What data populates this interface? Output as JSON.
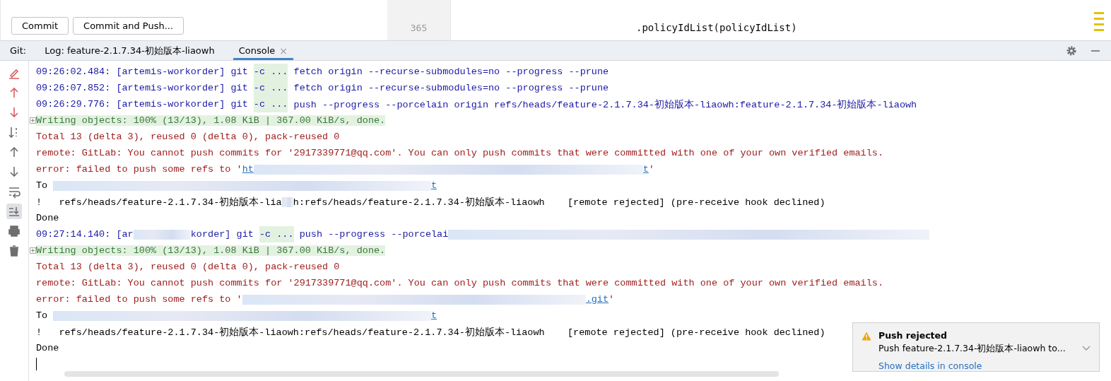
{
  "commit_buttons": [
    "Commit",
    "Commit and Push..."
  ],
  "editor": {
    "line_number": "365",
    "code": ".policyIdList(policyIdList)"
  },
  "tool_window": {
    "label": "Git:",
    "tabs": [
      {
        "label": "Log: feature-2.1.7.34-初始版本-liaowh",
        "selected": false
      },
      {
        "label": "Console",
        "selected": true,
        "close": "×"
      }
    ]
  },
  "toolbar": [
    {
      "kind": "pen",
      "on": false
    },
    {
      "kind": "up-red",
      "on": false
    },
    {
      "kind": "down-red",
      "on": false
    },
    {
      "kind": "sort",
      "on": false
    },
    {
      "kind": "up",
      "on": false
    },
    {
      "kind": "down",
      "on": false
    },
    {
      "kind": "wrap",
      "on": false
    },
    {
      "kind": "scroll-end",
      "on": true
    },
    {
      "kind": "print",
      "on": false
    },
    {
      "kind": "trash",
      "on": false
    }
  ],
  "console_lines": [
    {
      "kind": "command",
      "segments": [
        {
          "kind": "plain",
          "text": "09:26:02.484: [artemis-workorder] git "
        },
        {
          "kind": "flag",
          "text": "-c ..."
        },
        {
          "kind": "plain",
          "text": " fetch origin --recurse-submodules=no --progress --prune"
        }
      ]
    },
    {
      "kind": "command",
      "segments": [
        {
          "kind": "plain",
          "text": "09:26:07.852: [artemis-workorder] git "
        },
        {
          "kind": "flag",
          "text": "-c ..."
        },
        {
          "kind": "plain",
          "text": " fetch origin --recurse-submodules=no --progress --prune"
        }
      ]
    },
    {
      "kind": "command",
      "segments": [
        {
          "kind": "plain",
          "text": "09:26:29.776: [artemis-workorder] git "
        },
        {
          "kind": "flag",
          "text": "-c ..."
        },
        {
          "kind": "plain",
          "text": " push --progress --porcelain origin refs/heads/feature-2.1.7.34-初始版本-liaowh:feature-2.1.7.34-初始版本-liaowh"
        }
      ]
    },
    {
      "kind": "progress",
      "segments": [
        {
          "kind": "plain",
          "text": "Writing objects: 100% (13/13), 1.08 KiB | 367.00 KiB/s, done."
        }
      ]
    },
    {
      "kind": "error",
      "segments": [
        {
          "kind": "plain",
          "text": "Total 13 (delta 3), reused 0 (delta 0), pack-reused 0"
        }
      ]
    },
    {
      "kind": "error",
      "segments": [
        {
          "kind": "plain",
          "text": "remote: GitLab: You cannot push commits for '2917339771@qq.com'. You can only push commits that were committed with one of your own verified emails."
        }
      ]
    },
    {
      "kind": "error",
      "segments": [
        {
          "kind": "plain",
          "text": "error: failed to push some refs to '"
        },
        {
          "kind": "link",
          "text": "ht"
        },
        {
          "kind": "redacted"
        },
        {
          "kind": "link",
          "text": "t"
        },
        {
          "kind": "plain",
          "text": "'"
        }
      ]
    },
    {
      "kind": "normal",
      "segments": [
        {
          "kind": "plain",
          "text": "To "
        },
        {
          "kind": "redacted"
        },
        {
          "kind": "link",
          "text": "t"
        }
      ]
    },
    {
      "kind": "normal",
      "segments": [
        {
          "kind": "plain",
          "text": "!   refs/heads/feature-2.1.7.34-初始版本-lia"
        },
        {
          "kind": "redacted"
        },
        {
          "kind": "plain",
          "text": "h:refs/heads/feature-2.1.7.34-初始版本-liaowh    [remote rejected] (pre-receive hook declined)"
        }
      ]
    },
    {
      "kind": "normal",
      "segments": [
        {
          "kind": "plain",
          "text": "Done"
        }
      ]
    },
    {
      "kind": "command",
      "segments": [
        {
          "kind": "plain",
          "text": "09:27:14.140: [ar"
        },
        {
          "kind": "redacted"
        },
        {
          "kind": "plain",
          "text": "korder] git "
        },
        {
          "kind": "flag",
          "text": "-c ..."
        },
        {
          "kind": "plain",
          "text": " push --progress --porcelai"
        },
        {
          "kind": "redacted"
        }
      ]
    },
    {
      "kind": "progress",
      "segments": [
        {
          "kind": "plain",
          "text": "Writing objects: 100% (13/13), 1.08 KiB | 367.00 KiB/s, done."
        }
      ]
    },
    {
      "kind": "error",
      "segments": [
        {
          "kind": "plain",
          "text": "Total 13 (delta 3), reused 0 (delta 0), pack-reused 0"
        }
      ]
    },
    {
      "kind": "error",
      "segments": [
        {
          "kind": "plain",
          "text": "remote: GitLab: You cannot push commits for '2917339771@qq.com'. You can only push commits that were committed with one of your own verified emails."
        }
      ]
    },
    {
      "kind": "error",
      "segments": [
        {
          "kind": "plain",
          "text": "error: failed to push some refs to '"
        },
        {
          "kind": "redacted"
        },
        {
          "kind": "link",
          "text": ".git"
        },
        {
          "kind": "plain",
          "text": "'"
        }
      ]
    },
    {
      "kind": "normal",
      "segments": [
        {
          "kind": "plain",
          "text": "To "
        },
        {
          "kind": "redacted"
        },
        {
          "kind": "link",
          "text": "t"
        }
      ]
    },
    {
      "kind": "normal",
      "segments": [
        {
          "kind": "plain",
          "text": "!   refs/heads/feature-2.1.7.34-初始版本-liaowh:refs/heads/feature-2.1.7.34-初始版本-liaowh    [remote rejected] (pre-receive hook declined)"
        }
      ]
    },
    {
      "kind": "normal",
      "segments": [
        {
          "kind": "plain",
          "text": "Done"
        }
      ]
    }
  ],
  "notification": {
    "kind": "warning",
    "title": "Push rejected",
    "message": "Push feature-2.1.7.34-初始版本-liaowh to...",
    "action": "Show details in console"
  }
}
